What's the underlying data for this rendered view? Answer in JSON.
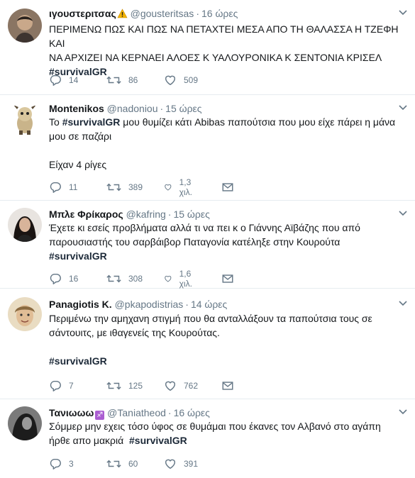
{
  "tweets": [
    {
      "name": "ιγουστεριτσας",
      "handle": "@gousteritsas",
      "time": "16 ώρες",
      "lines": [
        "ΠΕΡΙΜΕΝΩ ΠΩΣ ΚΑΙ ΠΩΣ ΝΑ ΠΕΤΑΧΤΕΙ ΜΕΣΑ ΑΠΟ ΤΗ ΘΑΛΑΣΣΑ Η ΤΖΕΦΗ ΚΑΙ",
        "ΝΑ ΑΡΧΙΖΕΙ ΝΑ ΚΕΡΝΑΕΙ ΑΛΟΕΣ Κ ΥΑΛΟΥΡΟΝΙΚΑ Κ ΣΕΝΤΟΝΙΑ ΚΡΙΣΕΛ"
      ],
      "hashtag": "#survivalGR",
      "replies": "14",
      "retweets": "86",
      "likes": "509",
      "avatar_color": "#6b5a4e"
    },
    {
      "name": "Montenikos",
      "handle": "@nadoniou",
      "time": "15 ώρες",
      "pre": "Το ",
      "hashtag": "#survivalGR",
      "post": " μου θυμίζει κάτι Abibas παπούτσια που μου είχε πάρει η μάνα",
      "line2": "μου σε παζάρι",
      "line3": "Είχαν 4 ρίγες",
      "replies": "11",
      "retweets": "389",
      "likes": "1,3 χιλ.",
      "avatar_color": "#c9b48a"
    },
    {
      "name": "Μπλε Φρίκαρος",
      "handle": "@kafring",
      "time": "15 ώρες",
      "lines": [
        "Έχετε κι εσείς προβλήματα αλλά τι να πει κ ο Γιάννης Αϊβάζης που από",
        "παρουσιαστής του σαρβάιβορ Παταγονία κατέληξε στην Κουρούτα"
      ],
      "hashtag": "#survivalGR",
      "replies": "16",
      "retweets": "308",
      "likes": "1,6 χιλ.",
      "avatar_color": "#2b2422"
    },
    {
      "name": "Panagiotis K.",
      "handle": "@pkapodistrias",
      "time": "14 ώρες",
      "lines": [
        "Περιμένω την αμηχανη στιγμή που θα ανταλλάξουν τα παπούτσια τους σε",
        "σάντουιτς, με ιθαγενείς της Κουρούτας."
      ],
      "hashtag": "#survivalGR",
      "replies": "7",
      "retweets": "125",
      "likes": "762",
      "avatar_color": "#b89a6a"
    },
    {
      "name": "Τανιωωω",
      "handle": "@Taniatheod",
      "time": "16 ώρες",
      "line1": "Σόμμερ μην εχεις τόσο ύφος σε θυμάμαι που έκανες τον Αλβανό στο αγάπη",
      "pre": "ήρθε απο μακριά  ",
      "hashtag": "#survivalGR",
      "replies": "3",
      "retweets": "60",
      "likes": "391",
      "avatar_color": "#3a3a3a"
    }
  ]
}
